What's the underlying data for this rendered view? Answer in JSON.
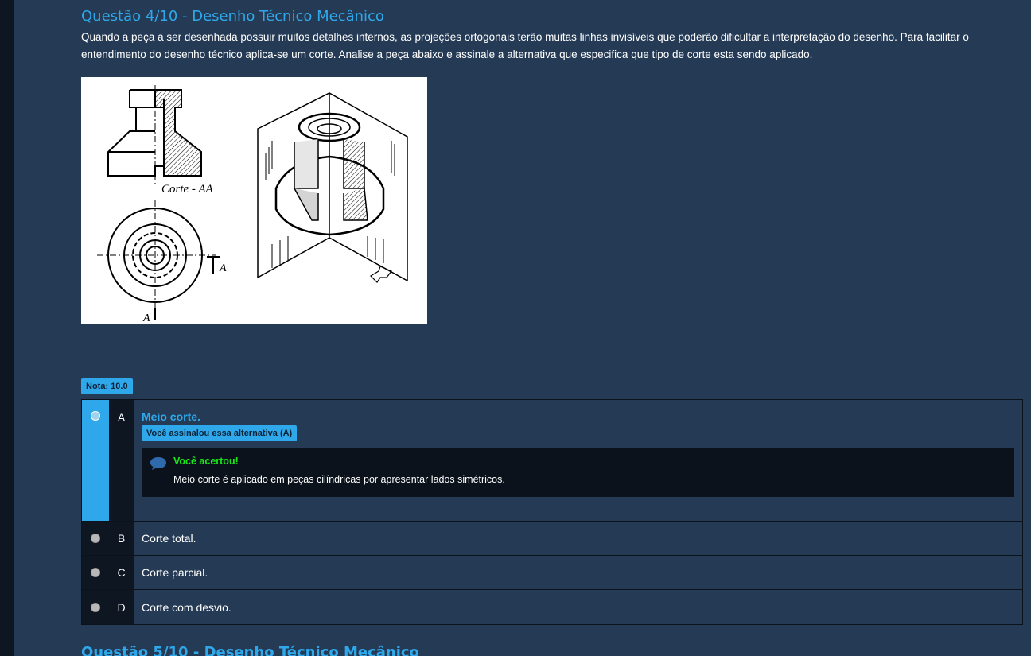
{
  "question": {
    "title": "Questão 4/10 - Desenho Técnico Mecânico",
    "text": "Quando a peça a ser desenhada possuir muitos detalhes internos, as projeções ortogonais terão muitas linhas invisíveis que poderão dificultar a interpretação do desenho. Para facilitar o entendimento do desenho técnico aplica-se um corte. Analise a peça abaixo e assinale a alternativa que especifica que tipo de corte esta sendo aplicado.",
    "figure_labels": {
      "section": "Corte - AA",
      "marker_a": "A",
      "marker_a_bottom": "A"
    }
  },
  "grade_badge": "Nota: 10.0",
  "options": [
    {
      "letter": "A",
      "label": "Meio corte.",
      "selected": true,
      "marked_badge": "Você assinalou essa alternativa (A)",
      "feedback": {
        "title": "Você acertou!",
        "text": "Meio corte é aplicado em peças cilíndricas por apresentar  lados simétricos."
      }
    },
    {
      "letter": "B",
      "label": "Corte total.",
      "selected": false
    },
    {
      "letter": "C",
      "label": "Corte parcial.",
      "selected": false
    },
    {
      "letter": "D",
      "label": "Corte com desvio.",
      "selected": false
    }
  ],
  "next_question_title": "Questão 5/10 - Desenho Técnico Mecânico",
  "colors": {
    "background": "#253a55",
    "accent": "#2ea8ea",
    "success": "#19e819",
    "dark": "#0d1621"
  },
  "icons": {
    "feedback": "speech-bubble-icon"
  }
}
